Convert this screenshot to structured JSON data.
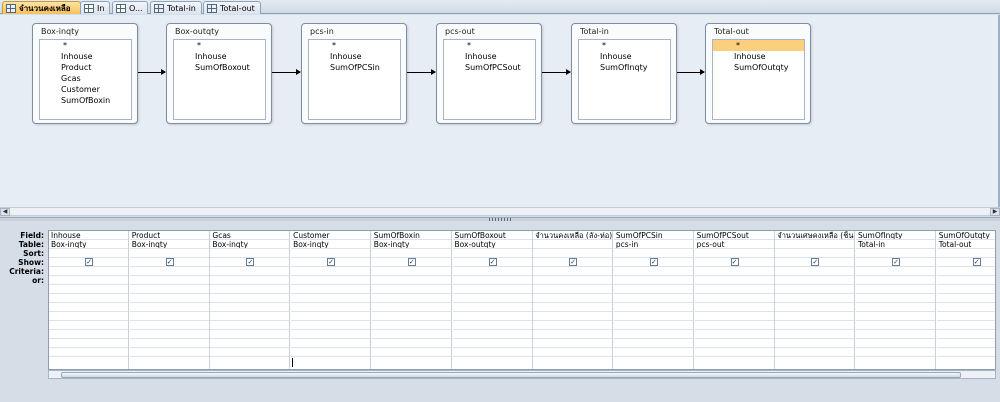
{
  "tabs": [
    {
      "label": "จำนวนคงเหลือ",
      "icon": "query-icon",
      "active": true
    },
    {
      "label": "In",
      "icon": "table-icon",
      "active": false
    },
    {
      "label": "O...",
      "icon": "table-icon",
      "active": false
    },
    {
      "label": "Total-in",
      "icon": "query-icon",
      "active": false
    },
    {
      "label": "Total-out",
      "icon": "query-icon",
      "active": false
    }
  ],
  "tables": [
    {
      "title": "Box-inqty",
      "fields": [
        "*",
        "Inhouse",
        "Product",
        "Gcas",
        "Customer",
        "SumOfBoxin"
      ]
    },
    {
      "title": "Box-outqty",
      "fields": [
        "*",
        "Inhouse",
        "SumOfBoxout"
      ]
    },
    {
      "title": "pcs-in",
      "fields": [
        "*",
        "Inhouse",
        "SumOfPCSin"
      ]
    },
    {
      "title": "pcs-out",
      "fields": [
        "*",
        "Inhouse",
        "SumOfPCSout"
      ]
    },
    {
      "title": "Total-in",
      "fields": [
        "*",
        "Inhouse",
        "SumOfInqty"
      ]
    },
    {
      "title": "Total-out",
      "fields": [
        "*",
        "Inhouse",
        "SumOfOutqty"
      ]
    }
  ],
  "grid": {
    "row_labels": [
      "Field:",
      "Table:",
      "Sort:",
      "Show:",
      "Criteria:",
      "or:"
    ],
    "columns": [
      {
        "field": "Inhouse",
        "table": "Box-inqty",
        "show": true
      },
      {
        "field": "Product",
        "table": "Box-inqty",
        "show": true
      },
      {
        "field": "Gcas",
        "table": "Box-inqty",
        "show": true
      },
      {
        "field": "Customer",
        "table": "Box-inqty",
        "show": true
      },
      {
        "field": "SumOfBoxin",
        "table": "Box-inqty",
        "show": true
      },
      {
        "field": "SumOfBoxout",
        "table": "Box-outqty",
        "show": true
      },
      {
        "field": "จำนวนคงเหลือ (ลัง-ห่อ):",
        "table": "",
        "show": true
      },
      {
        "field": "SumOfPCSin",
        "table": "pcs-in",
        "show": true
      },
      {
        "field": "SumOfPCSout",
        "table": "pcs-out",
        "show": true
      },
      {
        "field": "จำนวนเศษคงเหลือ (ชิ้น)",
        "table": "",
        "show": true
      },
      {
        "field": "SumOfInqty",
        "table": "Total-in",
        "show": true
      },
      {
        "field": "SumOfOutqty",
        "table": "Total-out",
        "show": true
      }
    ]
  },
  "icons": {
    "scroll_left": "scroll-left-icon",
    "scroll_right": "scroll-right-icon",
    "check": "check-icon"
  }
}
